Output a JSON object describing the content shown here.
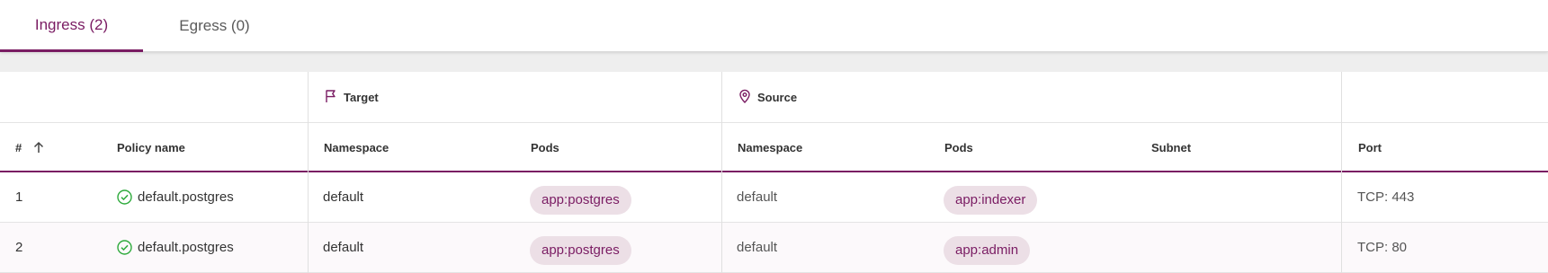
{
  "tabs": [
    {
      "label": "Ingress (2)",
      "active": true
    },
    {
      "label": "Egress (0)",
      "active": false
    }
  ],
  "table": {
    "groups": {
      "target": {
        "label": "Target",
        "icon": "flag-icon"
      },
      "source": {
        "label": "Source",
        "icon": "location-pin-icon"
      }
    },
    "columns": {
      "index": "#",
      "policy_name": "Policy name",
      "target_namespace": "Namespace",
      "target_pods": "Pods",
      "source_namespace": "Namespace",
      "source_pods": "Pods",
      "subnet": "Subnet",
      "port": "Port"
    },
    "sort": {
      "column": "#",
      "direction": "ascending",
      "icon": "arrow-up-icon"
    },
    "rows": [
      {
        "index": "1",
        "status_icon": "check-circle-icon",
        "policy_name": "default.postgres",
        "target_namespace": "default",
        "target_pods": "app:postgres",
        "source_namespace": "default",
        "source_pods": "app:indexer",
        "subnet": "",
        "port": "TCP: 443"
      },
      {
        "index": "2",
        "status_icon": "check-circle-icon",
        "policy_name": "default.postgres",
        "target_namespace": "default",
        "target_pods": "app:postgres",
        "source_namespace": "default",
        "source_pods": "app:admin",
        "subnet": "",
        "port": "TCP: 80"
      }
    ]
  },
  "colors": {
    "accent": "#7a1c63",
    "chip_bg": "#ecdfe6",
    "ok_green": "#2eaa3c"
  }
}
